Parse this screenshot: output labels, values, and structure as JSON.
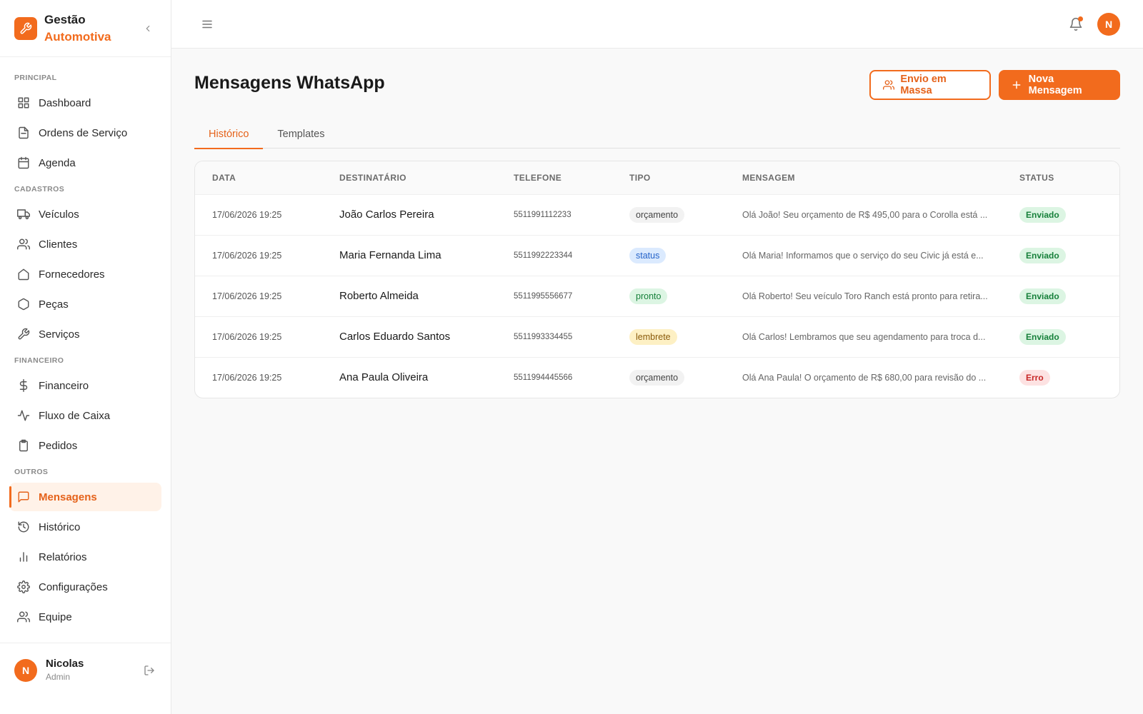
{
  "brand": {
    "line1": "Gestão",
    "line2": "Automotiva"
  },
  "sidebar": {
    "sections": [
      {
        "label": "PRINCIPAL",
        "items": [
          {
            "label": "Dashboard",
            "icon": "grid-icon"
          },
          {
            "label": "Ordens de Serviço",
            "icon": "file-icon"
          },
          {
            "label": "Agenda",
            "icon": "calendar-icon"
          }
        ]
      },
      {
        "label": "CADASTROS",
        "items": [
          {
            "label": "Veículos",
            "icon": "truck-icon"
          },
          {
            "label": "Clientes",
            "icon": "users-icon"
          },
          {
            "label": "Fornecedores",
            "icon": "home-icon"
          },
          {
            "label": "Peças",
            "icon": "hexagon-icon"
          },
          {
            "label": "Serviços",
            "icon": "wrench-icon"
          }
        ]
      },
      {
        "label": "FINANCEIRO",
        "items": [
          {
            "label": "Financeiro",
            "icon": "dollar-icon"
          },
          {
            "label": "Fluxo de Caixa",
            "icon": "activity-icon"
          },
          {
            "label": "Pedidos",
            "icon": "clipboard-icon"
          }
        ]
      },
      {
        "label": "OUTROS",
        "items": [
          {
            "label": "Mensagens",
            "icon": "message-icon",
            "active": true
          },
          {
            "label": "Histórico",
            "icon": "history-icon"
          },
          {
            "label": "Relatórios",
            "icon": "bar-chart-icon"
          },
          {
            "label": "Configurações",
            "icon": "gear-icon"
          },
          {
            "label": "Equipe",
            "icon": "team-icon"
          }
        ]
      }
    ]
  },
  "user": {
    "initial": "N",
    "name": "Nicolas",
    "role": "Admin"
  },
  "header": {
    "avatar_initial": "N"
  },
  "page": {
    "title": "Mensagens WhatsApp",
    "bulk_button": "Envio em Massa",
    "new_button": "Nova Mensagem"
  },
  "tabs": [
    {
      "label": "Histórico",
      "active": true
    },
    {
      "label": "Templates",
      "active": false
    }
  ],
  "table": {
    "columns": [
      "DATA",
      "DESTINATÁRIO",
      "TELEFONE",
      "TIPO",
      "MENSAGEM",
      "STATUS"
    ],
    "rows": [
      {
        "date": "17/06/2026 19:25",
        "name": "João Carlos Pereira",
        "phone": "5511991112233",
        "type": "orçamento",
        "type_key": "orcamento",
        "message": "Olá João! Seu orçamento de R$ 495,00 para o Corolla está ...",
        "status": "Enviado",
        "status_key": "enviado"
      },
      {
        "date": "17/06/2026 19:25",
        "name": "Maria Fernanda Lima",
        "phone": "5511992223344",
        "type": "status",
        "type_key": "status",
        "message": "Olá Maria! Informamos que o serviço do seu Civic já está e...",
        "status": "Enviado",
        "status_key": "enviado"
      },
      {
        "date": "17/06/2026 19:25",
        "name": "Roberto Almeida",
        "phone": "5511995556677",
        "type": "pronto",
        "type_key": "pronto",
        "message": "Olá Roberto! Seu veículo Toro Ranch está pronto para retira...",
        "status": "Enviado",
        "status_key": "enviado"
      },
      {
        "date": "17/06/2026 19:25",
        "name": "Carlos Eduardo Santos",
        "phone": "5511993334455",
        "type": "lembrete",
        "type_key": "lembrete",
        "message": "Olá Carlos! Lembramos que seu agendamento para troca d...",
        "status": "Enviado",
        "status_key": "enviado"
      },
      {
        "date": "17/06/2026 19:25",
        "name": "Ana Paula Oliveira",
        "phone": "5511994445566",
        "type": "orçamento",
        "type_key": "orcamento",
        "message": "Olá Ana Paula! O orçamento de R$ 680,00 para revisão do ...",
        "status": "Erro",
        "status_key": "erro"
      }
    ]
  },
  "colors": {
    "accent": "#f26b1d",
    "accent_soft": "#fff2e8"
  }
}
